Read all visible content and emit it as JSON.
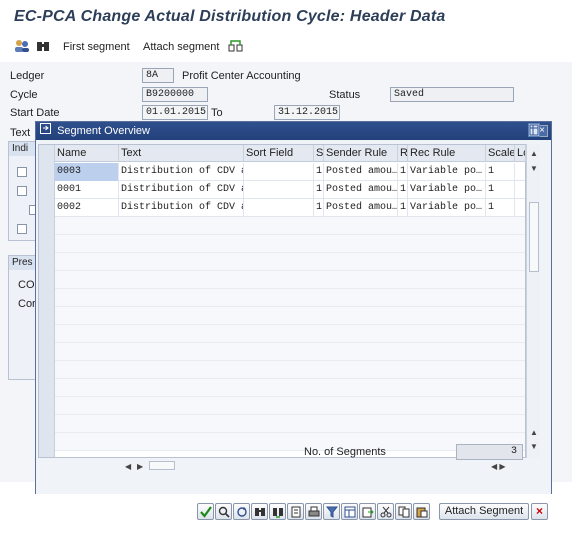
{
  "window": {
    "title": "EC-PCA Change Actual Distribution Cycle: Header Data"
  },
  "toolbar": {
    "first_segment": "First segment",
    "attach_segment": "Attach segment"
  },
  "header": {
    "ledger_label": "Ledger",
    "ledger_value": "8A",
    "ledger_text": "Profit Center Accounting",
    "cycle_label": "Cycle",
    "cycle_value": "B9200000",
    "status_label": "Status",
    "status_value": "Saved",
    "start_date_label": "Start Date",
    "start_date_value": "01.01.2015",
    "to_label": "To",
    "to_value": "31.12.2015",
    "text_label": "Text",
    "ind_group": "Indi",
    "pres_group": "Pres",
    "co_label": "CO",
    "cor_label": "Cor"
  },
  "dialog": {
    "title": "Segment Overview",
    "close": "×",
    "columns": [
      "Name",
      "Text",
      "Sort Field",
      "S",
      "Sender Rule",
      "R",
      "Rec Rule",
      "Scale",
      "Lc"
    ],
    "rows": [
      {
        "name": "0003",
        "text": "Distribution of CDV at PI…",
        "sort": "",
        "s": "1",
        "sender_rule": "Posted amou…",
        "r": "1",
        "rec_rule": "Variable po…",
        "scale": "1"
      },
      {
        "name": "0001",
        "text": "Distribution of CDV at PI…",
        "sort": "",
        "s": "1",
        "sender_rule": "Posted amou…",
        "r": "1",
        "rec_rule": "Variable po…",
        "scale": "1"
      },
      {
        "name": "0002",
        "text": "Distribution of CDV at PI…",
        "sort": "",
        "s": "1",
        "sender_rule": "Posted amou…",
        "r": "1",
        "rec_rule": "Variable po…",
        "scale": "1"
      }
    ],
    "segments_label": "No. of Segments",
    "segments_count": "3",
    "attach_button": "Attach Segment",
    "cancel_button": "×"
  },
  "colors": {
    "title_text": "#2c3e58",
    "dialog_header": "#22417c",
    "cancel_red": "#cc0000"
  }
}
